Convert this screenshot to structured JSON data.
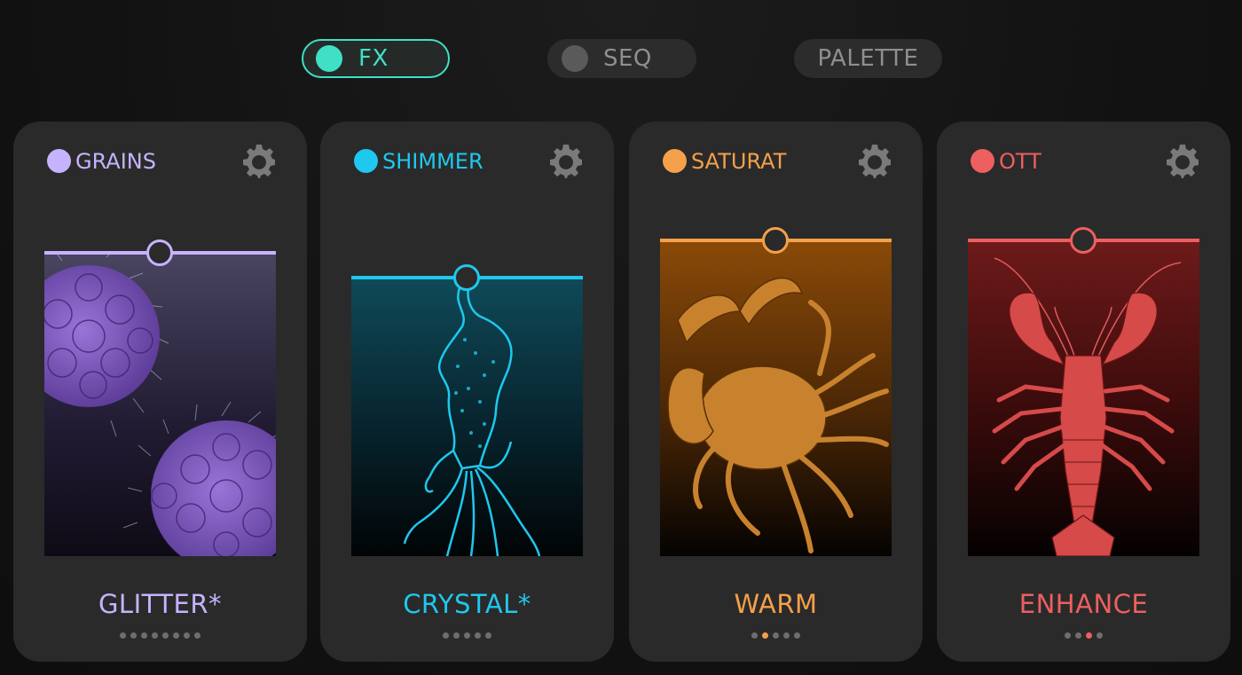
{
  "tabs": {
    "fx": "FX",
    "seq": "SEQ",
    "palette": "PALETTE"
  },
  "colors": {
    "accent_teal": "#3fe0c5",
    "grains": "#c6b3ff",
    "shimmer": "#1ec8ee",
    "saturat": "#f5a04a",
    "ott": "#ee5f5f",
    "inactive": "#8f8f8f"
  },
  "cards": [
    {
      "name": "GRAINS",
      "preset": "GLITTER*",
      "icon": "gear-icon",
      "art": "sea-urchin-illustration",
      "level": 0.96,
      "dot_count": 8,
      "active_dot": -1
    },
    {
      "name": "SHIMMER",
      "preset": "CRYSTAL*",
      "icon": "gear-icon",
      "art": "squid-illustration",
      "level": 0.91,
      "dot_count": 5,
      "active_dot": -1
    },
    {
      "name": "SATURAT",
      "preset": "WARM",
      "icon": "gear-icon",
      "art": "crab-illustration",
      "level": 1.0,
      "dot_count": 5,
      "active_dot": 1
    },
    {
      "name": "OTT",
      "preset": "ENHANCE",
      "icon": "gear-icon",
      "art": "lobster-illustration",
      "level": 1.0,
      "dot_count": 4,
      "active_dot": 2
    }
  ]
}
